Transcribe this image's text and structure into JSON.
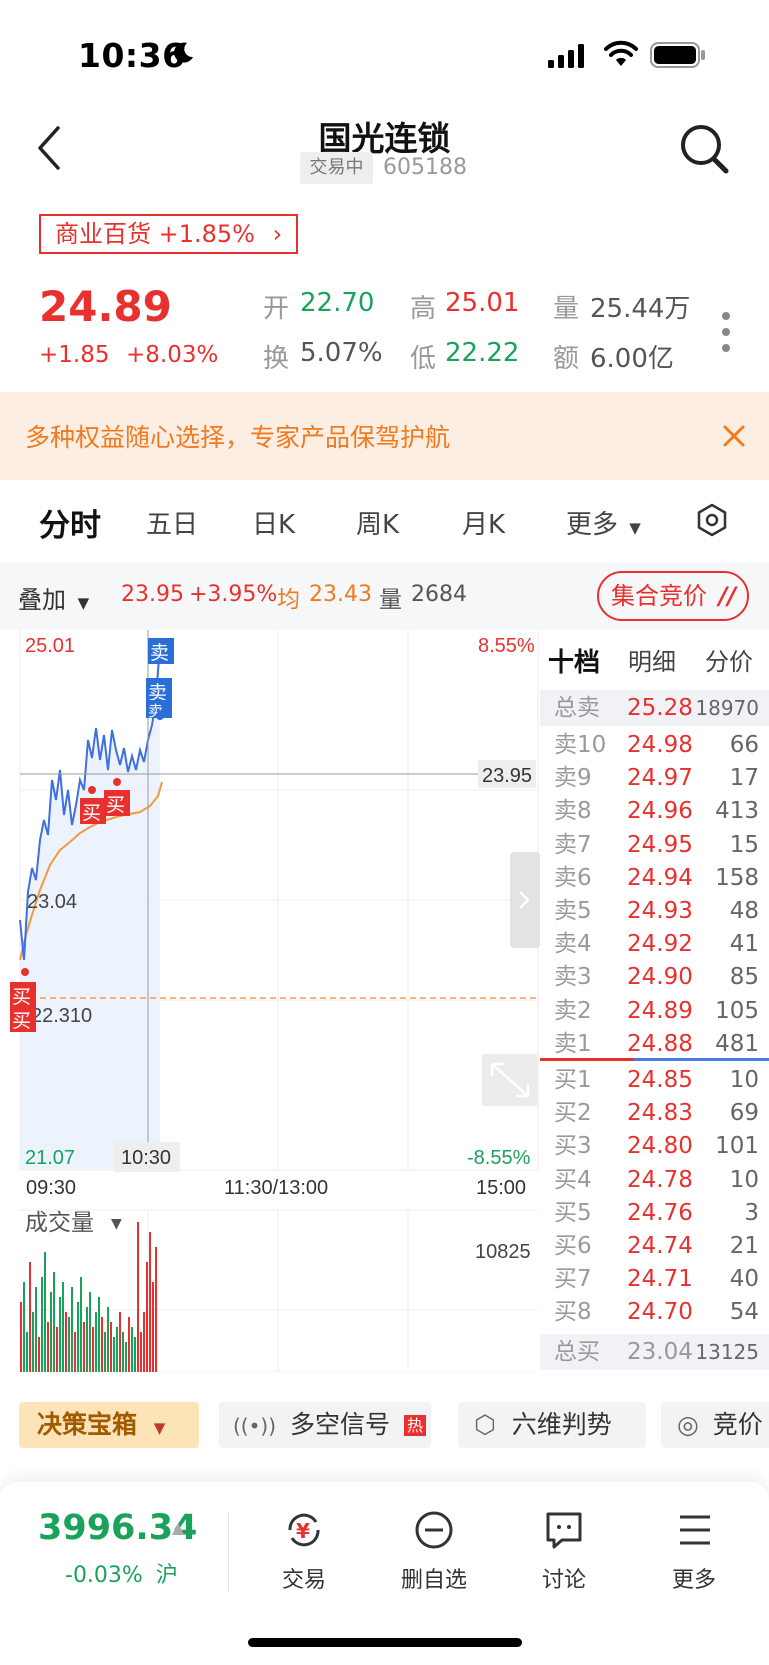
{
  "status": {
    "time": "10:36"
  },
  "header": {
    "title": "国光连锁",
    "badge": "交易中",
    "code": "605188"
  },
  "sector": {
    "label": "商业百货 +1.85%",
    "chevron": "›"
  },
  "quote": {
    "price": "24.89",
    "change": "+1.85",
    "change_pct": "+8.03%",
    "fields": [
      {
        "label": "开",
        "value": "22.70",
        "color": "green"
      },
      {
        "label": "高",
        "value": "25.01",
        "color": "red"
      },
      {
        "label": "量",
        "value": "25.44万",
        "color": "gray"
      },
      {
        "label": "换",
        "value": "5.07%",
        "color": "gray"
      },
      {
        "label": "低",
        "value": "22.22",
        "color": "green"
      },
      {
        "label": "额",
        "value": "6.00亿",
        "color": "gray"
      }
    ]
  },
  "banner": {
    "text": "多种权益随心选择，专家产品保驾护航",
    "close": "×"
  },
  "tabs": [
    "分时",
    "五日",
    "日K",
    "周K",
    "月K",
    "更多"
  ],
  "overlay": {
    "label": "叠加",
    "price": "23.95",
    "pct": "+3.95%",
    "avg_label": "均",
    "avg": "23.43",
    "vol_label": "量",
    "vol": "2684",
    "auction": "集合竞价"
  },
  "chart_labels": {
    "high": "25.01",
    "high_pct": "8.55%",
    "low": "21.07",
    "low_pct": "-8.55%",
    "mid": "23.04",
    "ref": "22.310",
    "cursor_price": "23.95",
    "cursor_time": "10:30",
    "t_open": "09:30",
    "t_mid": "11:30/13:00",
    "t_close": "15:00",
    "volume_label": "成交量",
    "volume_max": "10825",
    "buy": "买",
    "sell": "卖"
  },
  "book": {
    "tabs": [
      "十档",
      "明细",
      "分价"
    ],
    "total_sell": {
      "label": "总卖",
      "price": "25.28",
      "vol": "18970"
    },
    "asks": [
      {
        "label": "卖10",
        "price": "24.98",
        "vol": "66"
      },
      {
        "label": "卖9",
        "price": "24.97",
        "vol": "17"
      },
      {
        "label": "卖8",
        "price": "24.96",
        "vol": "413"
      },
      {
        "label": "卖7",
        "price": "24.95",
        "vol": "15"
      },
      {
        "label": "卖6",
        "price": "24.94",
        "vol": "158"
      },
      {
        "label": "卖5",
        "price": "24.93",
        "vol": "48"
      },
      {
        "label": "卖4",
        "price": "24.92",
        "vol": "41"
      },
      {
        "label": "卖3",
        "price": "24.90",
        "vol": "85"
      },
      {
        "label": "卖2",
        "price": "24.89",
        "vol": "105"
      },
      {
        "label": "卖1",
        "price": "24.88",
        "vol": "481"
      }
    ],
    "bids": [
      {
        "label": "买1",
        "price": "24.85",
        "vol": "10"
      },
      {
        "label": "买2",
        "price": "24.83",
        "vol": "69"
      },
      {
        "label": "买3",
        "price": "24.80",
        "vol": "101"
      },
      {
        "label": "买4",
        "price": "24.78",
        "vol": "10"
      },
      {
        "label": "买5",
        "price": "24.76",
        "vol": "3"
      },
      {
        "label": "买6",
        "price": "24.74",
        "vol": "21"
      },
      {
        "label": "买7",
        "price": "24.71",
        "vol": "40"
      },
      {
        "label": "买8",
        "price": "24.70",
        "vol": "54"
      }
    ],
    "total_buy": {
      "label": "总买",
      "price": "23.04",
      "vol": "13125"
    }
  },
  "tools": [
    "决策宝箱",
    "多空信号",
    "热",
    "六维判势",
    "竞价"
  ],
  "bottom": {
    "index_value": "3996.34",
    "index_chg": "-0.03%",
    "index_market": "沪",
    "nav": [
      "交易",
      "删自选",
      "讨论",
      "更多"
    ]
  }
}
